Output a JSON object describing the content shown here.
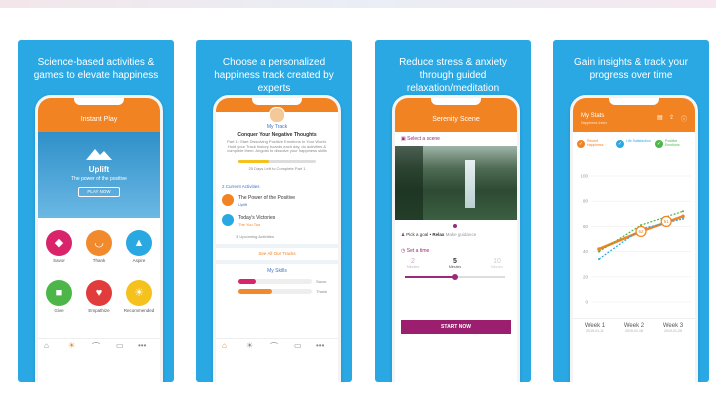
{
  "panels": [
    {
      "caption": "Science-based activities & games to elevate happiness",
      "screen_title": "Instant Play",
      "hero_title": "Uplift",
      "hero_subtitle": "The power of the positive",
      "play_button": "PLAY NOW",
      "activities": [
        {
          "label": "Savor",
          "color": "#d9246c",
          "icon": "ice-cream-icon"
        },
        {
          "label": "Thank",
          "color": "#f08a2c",
          "icon": "hands-icon"
        },
        {
          "label": "Aspire",
          "color": "#2aa8e2",
          "icon": "mountain-icon"
        },
        {
          "label": "Give",
          "color": "#4cb748",
          "icon": "gift-icon"
        },
        {
          "label": "Empathize",
          "color": "#e23b3b",
          "icon": "heart-icon"
        },
        {
          "label": "Recommended",
          "color": "#f4c11d",
          "icon": "sun-icon"
        }
      ],
      "nav_icons": [
        "home-icon",
        "sun-icon",
        "rainbow-icon",
        "chat-icon",
        "more-icon"
      ]
    },
    {
      "caption": "Choose a personalized happiness track created by experts",
      "track_label": "My Track",
      "track_name": "Conquer Your Negative Thoughts",
      "track_desc": "Part 1: Start Dissolving Positive Emotions In Your World. Hold your Track history boards each day, do activities & complete them. Angoist to dissolve your happiness skills",
      "progress_text": "25 Days Left to Complete Part 1",
      "current_activities_label": "2 Current Activities",
      "activities": [
        {
          "title": "The Power of the Positive",
          "subtitle": "Uplift"
        },
        {
          "title": "Today's Victories",
          "subtitle": "The You Too"
        }
      ],
      "upcoming_label": "3 Upcoming Activities",
      "see_all": "See All Our Tracks",
      "skills_label": "My Skills",
      "skills": [
        "Savor",
        "Thank"
      ],
      "nav_icons": [
        "home-icon",
        "sun-icon",
        "rainbow-icon",
        "chat-icon",
        "more-icon"
      ]
    },
    {
      "caption": "Reduce stress & anxiety through guided relaxation/meditation",
      "screen_title": "Serenity Scene",
      "select_scene": "Select a scene",
      "goal_label": "Pick a goal",
      "goal_value": "Relax",
      "goal_extra": "Make guidance",
      "set_time": "Set a time",
      "times": [
        {
          "value": "2",
          "unit": "Minutes"
        },
        {
          "value": "5",
          "unit": "Minutes"
        },
        {
          "value": "10",
          "unit": "Minutes"
        }
      ],
      "start_button": "START NOW"
    },
    {
      "caption": "Gain insights & track your progress over time",
      "screen_title": "My Stats",
      "screen_subtitle": "Happiness Index",
      "metrics": [
        "Recent Happiness",
        "Life Satisfaction",
        "Positive Emotions"
      ],
      "y_ticks": [
        "100",
        "80",
        "60",
        "40",
        "20",
        "0"
      ],
      "weeks": [
        {
          "label": "Week 1",
          "date": "2019-01-11"
        },
        {
          "label": "Week 2",
          "date": "2019-01-18"
        },
        {
          "label": "Week 3",
          "date": "2019-01-25"
        }
      ],
      "markers": [
        "62",
        "61"
      ]
    }
  ],
  "chart_data": {
    "type": "line",
    "categories": [
      "Week 1",
      "Week 2",
      "Week 3"
    ],
    "ylim": [
      0,
      100
    ],
    "series": [
      {
        "values": [
          42,
          56,
          68
        ],
        "color": "#f28322"
      },
      {
        "values": [
          34,
          58,
          66
        ],
        "color": "#2aa8e2"
      },
      {
        "values": [
          40,
          61,
          72
        ],
        "color": "#4cb748"
      }
    ]
  }
}
